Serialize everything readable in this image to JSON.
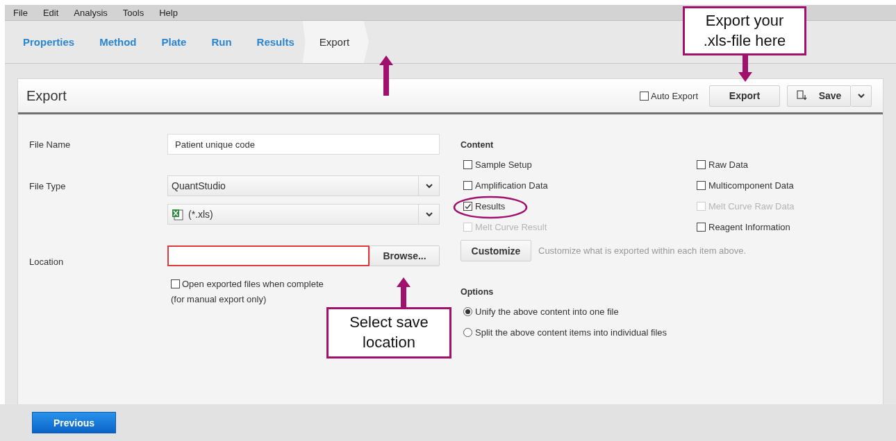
{
  "menu": [
    {
      "label": "File"
    },
    {
      "label": "Edit"
    },
    {
      "label": "Analysis"
    },
    {
      "label": "Tools"
    },
    {
      "label": "Help"
    }
  ],
  "tabs": [
    {
      "label": "Properties",
      "selected": false
    },
    {
      "label": "Method",
      "selected": false
    },
    {
      "label": "Plate",
      "selected": false
    },
    {
      "label": "Run",
      "selected": false
    },
    {
      "label": "Results",
      "selected": false
    },
    {
      "label": "Export",
      "selected": true
    }
  ],
  "panel": {
    "title": "Export",
    "auto_export": {
      "label": "Auto Export",
      "checked": false
    },
    "export_button": "Export",
    "save_button": "Save"
  },
  "form": {
    "file_name": {
      "label": "File Name",
      "value": "Patient unique code"
    },
    "file_type": {
      "label": "File Type",
      "value": "QuantStudio",
      "format": "(*.xls)"
    },
    "location": {
      "label": "Location",
      "invalid": true,
      "browse_button": "Browse..."
    },
    "open_when_complete": {
      "label": "Open exported files when complete",
      "checked": false
    },
    "note": "(for manual export only)"
  },
  "content": {
    "title": "Content",
    "items": [
      {
        "label": "Sample Setup",
        "checked": false,
        "disabled": false
      },
      {
        "label": "Amplification Data",
        "checked": false,
        "disabled": false
      },
      {
        "label": "Results",
        "checked": true,
        "disabled": false
      },
      {
        "label": "Melt Curve Result",
        "checked": false,
        "disabled": true
      },
      {
        "label": "Raw Data",
        "checked": false,
        "disabled": false
      },
      {
        "label": "Multicomponent Data",
        "checked": false,
        "disabled": false
      },
      {
        "label": "Melt Curve Raw Data",
        "checked": false,
        "disabled": true
      },
      {
        "label": "Reagent Information",
        "checked": false,
        "disabled": false
      }
    ],
    "customize_button": "Customize",
    "hint": "Customize what is exported within each item above."
  },
  "options": {
    "title": "Options",
    "items": [
      {
        "label": "Unify the above content into one file",
        "selected": true
      },
      {
        "label": "Split the above content items into individual files",
        "selected": false
      }
    ]
  },
  "footer": {
    "previous_button": "Previous"
  },
  "annotations": [
    {
      "kind": "arrow"
    },
    {
      "kind": "callout",
      "lines": [
        "Export your",
        ".xls-file here"
      ]
    },
    {
      "kind": "arrow"
    },
    {
      "kind": "ellipse"
    },
    {
      "kind": "callout",
      "lines": [
        "Select save",
        "location"
      ]
    },
    {
      "kind": "arrow"
    }
  ]
}
